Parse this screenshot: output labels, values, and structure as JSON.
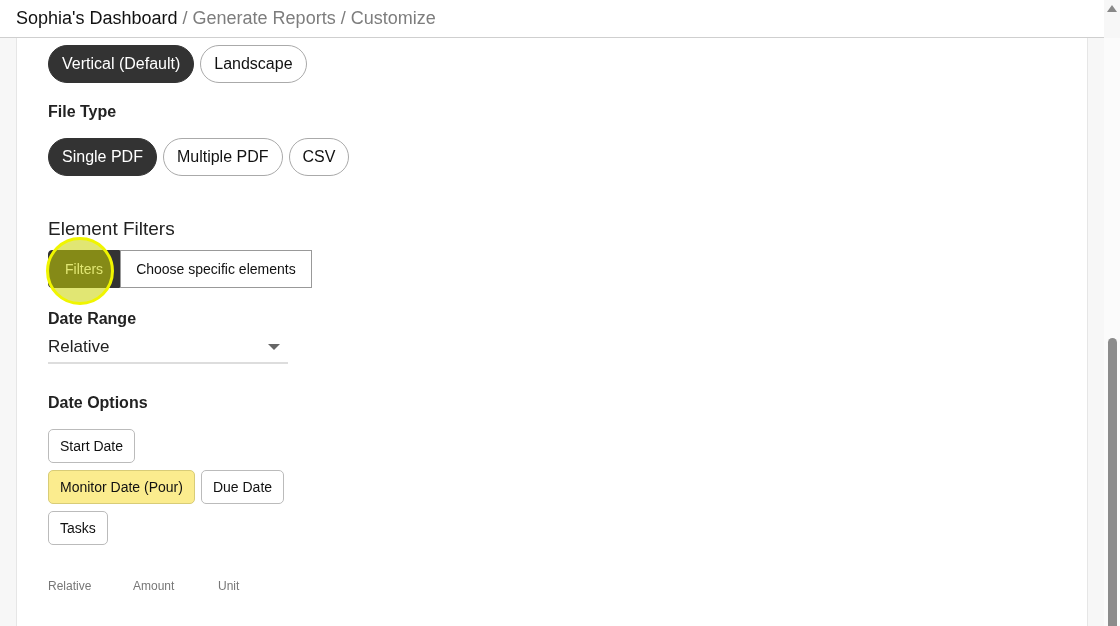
{
  "breadcrumb": {
    "root": "Sophia's Dashboard",
    "trail": [
      {
        "separator": "/",
        "label": "Generate Reports"
      },
      {
        "separator": "/",
        "label": "Customize"
      }
    ]
  },
  "orientation": {
    "options": [
      {
        "label": "Vertical (Default)",
        "selected": true
      },
      {
        "label": "Landscape",
        "selected": false
      }
    ]
  },
  "file_type": {
    "title": "File Type",
    "options": [
      {
        "label": "Single PDF",
        "selected": true
      },
      {
        "label": "Multiple PDF",
        "selected": false
      },
      {
        "label": "CSV",
        "selected": false
      }
    ]
  },
  "element_filters": {
    "title": "Element Filters",
    "options": [
      {
        "label": "Filters",
        "selected": true,
        "click_highlight": true
      },
      {
        "label": "Choose specific elements",
        "selected": false,
        "click_highlight": false
      }
    ]
  },
  "date_range": {
    "title": "Date Range",
    "value": "Relative"
  },
  "date_options": {
    "title": "Date Options",
    "rows": [
      [
        {
          "label": "Start Date",
          "selected": false
        }
      ],
      [
        {
          "label": "Monitor Date (Pour)",
          "selected": true
        },
        {
          "label": "Due Date",
          "selected": false
        }
      ],
      [
        {
          "label": "Tasks",
          "selected": false
        }
      ]
    ]
  },
  "relative_columns": [
    "Relative",
    "Amount",
    "Unit"
  ]
}
